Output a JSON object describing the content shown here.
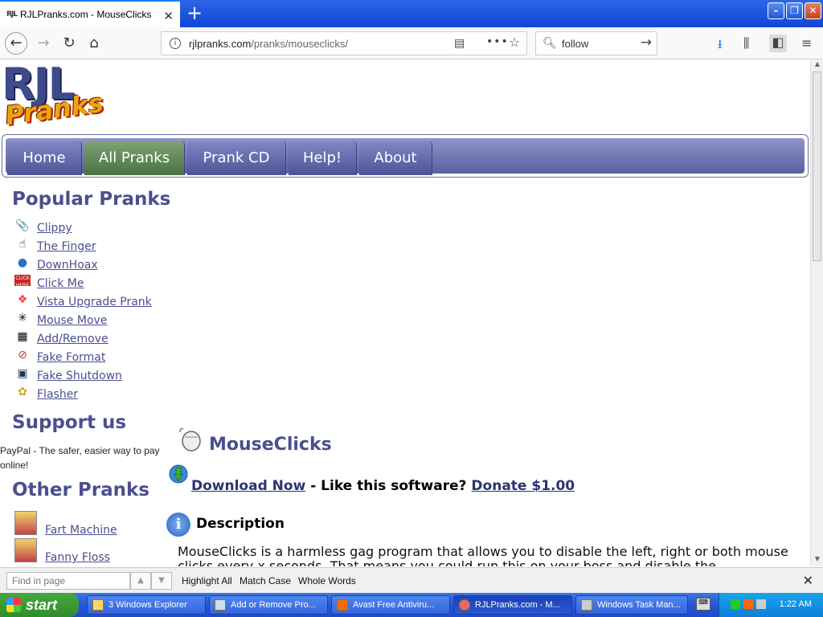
{
  "browser": {
    "tab_favicon": "RJL",
    "tab_title": "RJLPranks.com - MouseClicks",
    "url_host": "rjlpranks.com",
    "url_path": "/pranks/mouseclicks/",
    "search_value": "follow",
    "icons": [
      "back-icon",
      "forward-icon",
      "reload-icon",
      "home-icon",
      "info-icon",
      "reader-view-icon",
      "more-icon",
      "bookmark-star-icon",
      "search-icon",
      "download-icon",
      "library-icon",
      "sidebar-icon",
      "hamburger-menu-icon"
    ]
  },
  "logo": {
    "line1": "RJL",
    "line2": "Pranks"
  },
  "nav": {
    "items": [
      {
        "label": "Home",
        "active": false
      },
      {
        "label": "All Pranks",
        "active": true
      },
      {
        "label": "Prank CD",
        "active": false
      },
      {
        "label": "Help!",
        "active": false
      },
      {
        "label": "About",
        "active": false
      }
    ]
  },
  "sidebar": {
    "popular_heading": "Popular Pranks",
    "popular": [
      {
        "label": "Clippy",
        "icon": "paperclip-icon"
      },
      {
        "label": "The Finger",
        "icon": "hand-icon"
      },
      {
        "label": "DownHoax",
        "icon": "globe-icon"
      },
      {
        "label": "Click Me",
        "icon": "click-here-icon"
      },
      {
        "label": "Vista Upgrade Prank",
        "icon": "windows-logo-icon"
      },
      {
        "label": "Mouse Move",
        "icon": "move-arrows-icon"
      },
      {
        "label": "Add/Remove",
        "icon": "control-panel-icon"
      },
      {
        "label": "Fake Format",
        "icon": "no-disk-icon"
      },
      {
        "label": "Fake Shutdown",
        "icon": "computer-icon"
      },
      {
        "label": "Flasher",
        "icon": "flasher-icon"
      }
    ],
    "support_heading": "Support us",
    "paypal_text": "PayPal - The safer, easier way to pay online!",
    "other_heading": "Other Pranks",
    "other": [
      {
        "label": "Fart Machine"
      },
      {
        "label": "Fanny Floss"
      }
    ]
  },
  "content": {
    "title": "MouseClicks",
    "download_link": "Download Now",
    "download_sep": " - Like this software? ",
    "donate_link": "Donate $1.00",
    "description_heading": "Description",
    "description_text": "MouseClicks is a harmless gag program that allows you to disable the left, right or both mouse clicks every x seconds. That means you could run this on your boss and disable the"
  },
  "findbar": {
    "placeholder": "Find in page",
    "highlight_all": "Highlight All",
    "match_case": "Match Case",
    "whole_words": "Whole Words"
  },
  "taskbar": {
    "start": "start",
    "tasks": [
      {
        "label": "3 Windows Explorer",
        "active": false
      },
      {
        "label": "Add or Remove Pro...",
        "active": false
      },
      {
        "label": "Avast Free Antiviru...",
        "active": false
      },
      {
        "label": "RJLPranks.com - M...",
        "active": true
      },
      {
        "label": "Windows Task Man...",
        "active": false
      }
    ],
    "clock": "1:22 AM"
  },
  "colors": {
    "link": "#4a4f8e",
    "nav_active": "#5a8050",
    "nav_bg": "#6b70ad"
  }
}
